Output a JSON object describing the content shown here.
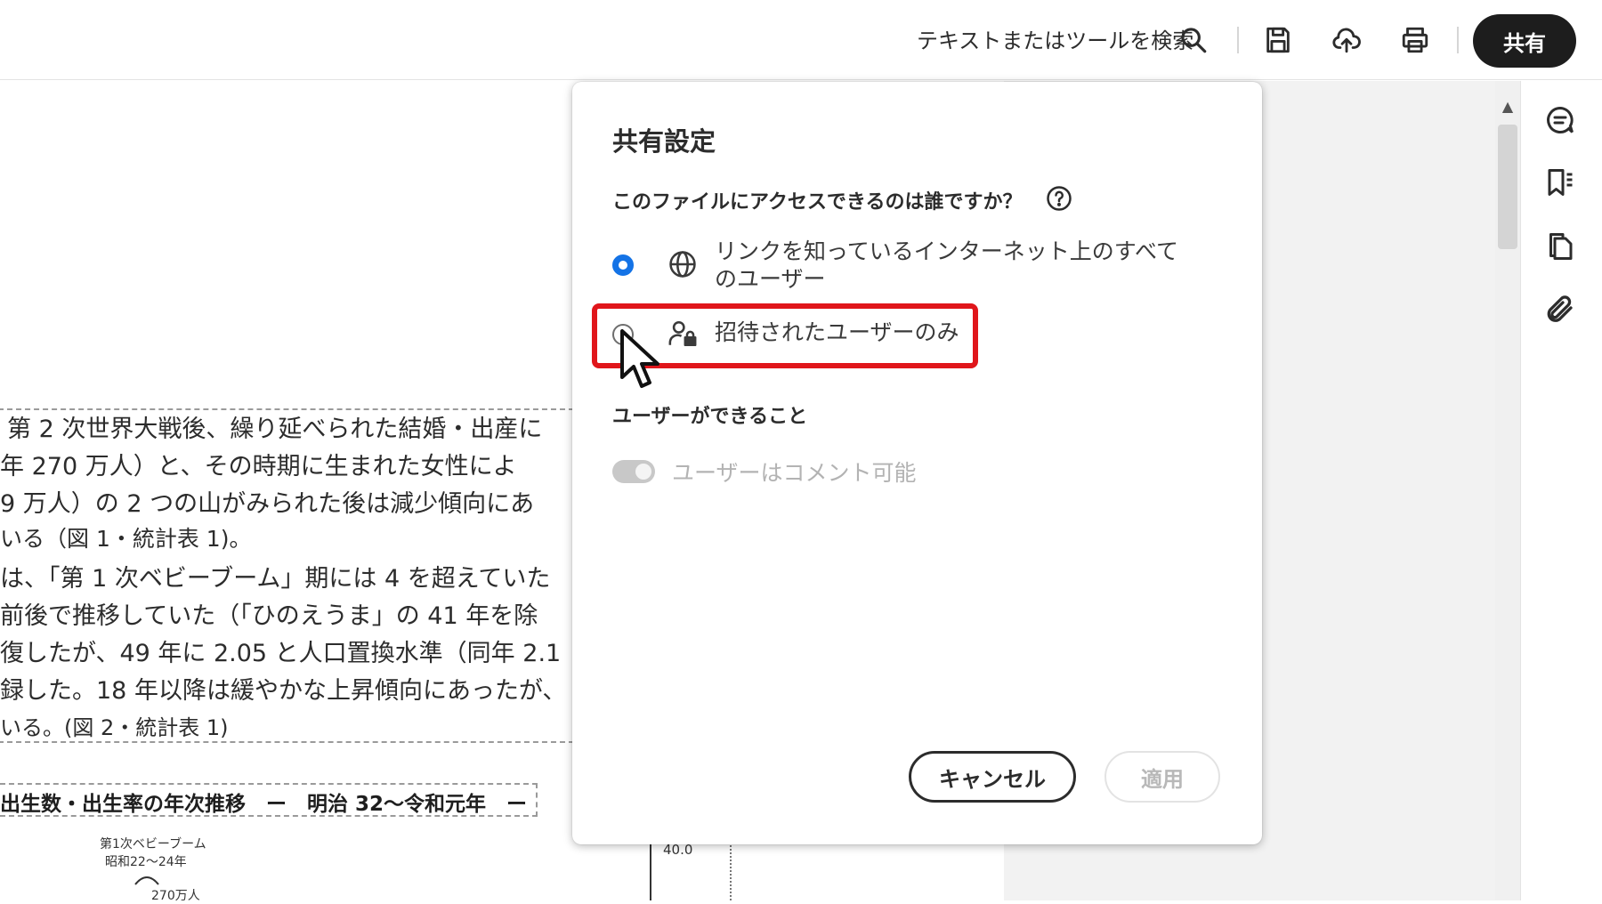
{
  "toolbar": {
    "search_label": "テキストまたはツールを検索",
    "icons": [
      "search-icon",
      "save-icon",
      "cloud-upload-icon",
      "print-icon"
    ],
    "share_label": "共有"
  },
  "document": {
    "lines": [
      "第 2 次世界大戦後、繰り延べられた結婚・出産に",
      "年 270 万人）と、その時期に生まれた女性によ",
      "9 万人）の 2 つの山がみられた後は減少傾向にあ",
      "いる（図 1・統計表 1)。",
      "は、「第 1 次ベビーブーム」期には 4 を超えていた",
      "前後で推移していた（「ひのえうま」の 41 年を除",
      "復したが、49 年に 2.05 と人口置換水準（同年 2.1",
      "録した。18 年以降は緩やかな上昇傾向にあったが、",
      "いる。(図 2・統計表 1)"
    ],
    "figure_title": "出生数・出生率の年次推移　ー　明治 32〜令和元年　ー",
    "figure_note_1": "第1次ベビーブーム",
    "figure_note_2": "昭和22〜24年",
    "figure_note_3": "270万人",
    "axis_tick": "40.0"
  },
  "dialog": {
    "title": "共有設定",
    "question": "このファイルにアクセスできるのは誰ですか？",
    "option_anyone": "リンクを知っているインターネット上のすべてのユーザー",
    "option_invited": "招待されたユーザーのみ",
    "permissions_heading": "ユーザーができること",
    "comment_toggle_label": "ユーザーはコメント可能",
    "cancel_label": "キャンセル",
    "apply_label": "適用"
  },
  "right_rail": {
    "icons": [
      "comment-icon",
      "bookmark-icon",
      "pages-icon",
      "attachment-icon"
    ]
  },
  "colors": {
    "accent_blue": "#1473e6",
    "highlight_red": "#e0161b",
    "share_button_bg": "#1d1d1d"
  }
}
